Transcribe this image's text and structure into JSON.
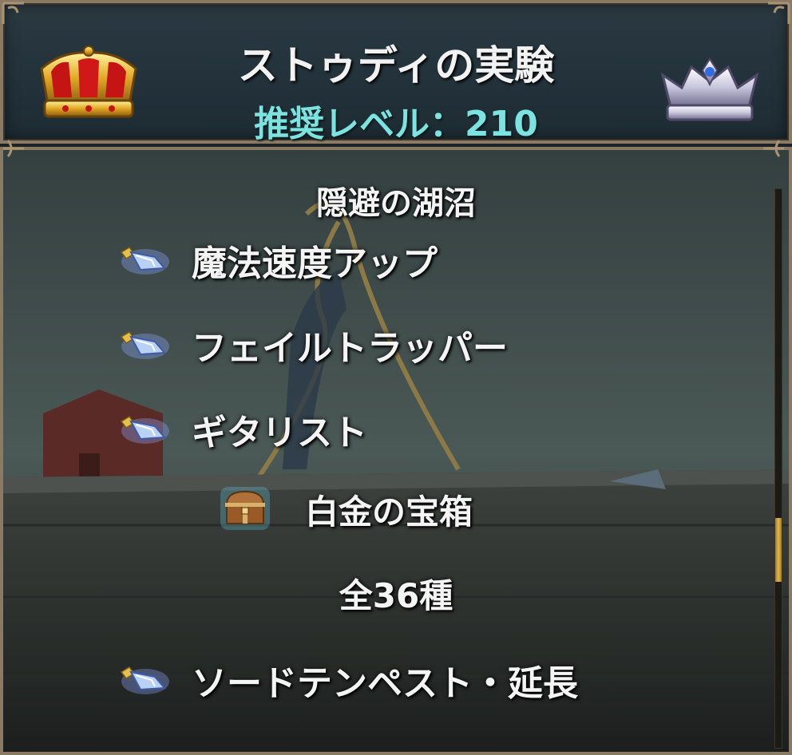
{
  "header": {
    "title": "ストゥディの実験",
    "recommended_level": "推奨レベル：210",
    "left_icon": "gold-crown-icon",
    "right_icon": "silver-crown-icon"
  },
  "panel": {
    "area_name": "隠避の湖沼",
    "rewards_top": [
      {
        "icon": "blue-crystal-icon",
        "label": "魔法速度アップ"
      },
      {
        "icon": "blue-crystal-icon",
        "label": "フェイルトラッパー"
      },
      {
        "icon": "blue-crystal-icon",
        "label": "ギタリスト"
      }
    ],
    "chest": {
      "icon": "treasure-chest-icon",
      "label": "白金の宝箱"
    },
    "count": "全36種",
    "rewards_bottom": [
      {
        "icon": "blue-crystal-icon",
        "label": "ソードテンペスト・延長"
      }
    ]
  },
  "colors": {
    "title_text": "#f2f2f2",
    "level_text": "#7be3e0",
    "frame_border": "#8a7a63",
    "scroll_thumb": "#e2b84a"
  }
}
